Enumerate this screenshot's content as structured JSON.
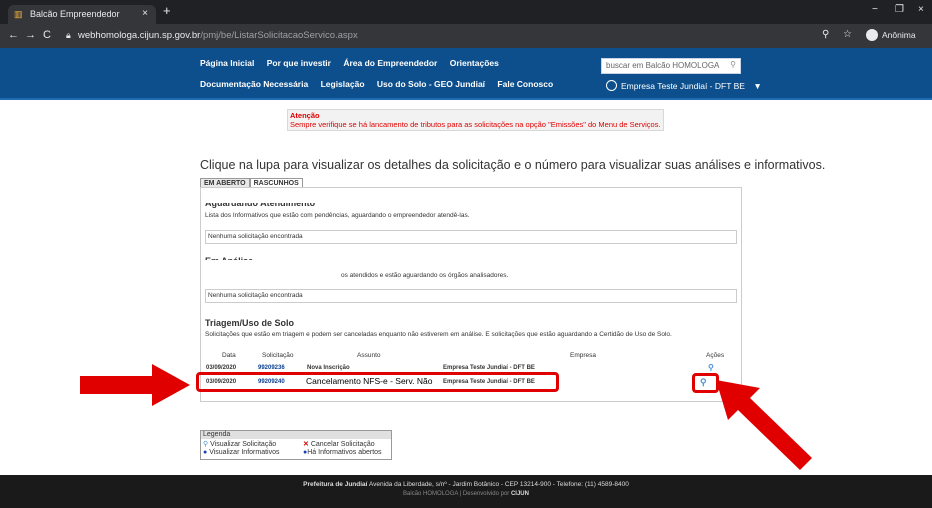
{
  "browser": {
    "tab_title": "Balcão Empreendedor",
    "tab_close": "×",
    "new_tab": "+",
    "url_host": "webhomologa.cijun.sp.gov.br",
    "url_path": "/pmj/be/ListarSolicitacaoServico.aspx",
    "profile_label": "Anônima",
    "window_controls": [
      "−",
      "❐",
      "×"
    ]
  },
  "site": {
    "nav_row1": [
      "Página Inicial",
      "Por que investir",
      "Área do Empreendedor",
      "Orientações"
    ],
    "nav_row2": [
      "Documentação Necessária",
      "Legislação",
      "Uso do Solo - GEO Jundiaí",
      "Fale Conosco"
    ],
    "search_placeholder": "buscar em Balcão HOMOLOGA",
    "company": "Empresa Teste Jundiaí - DFT BE",
    "company_caret": "▼"
  },
  "alert": {
    "title": "Atenção",
    "message": "Sempre verifique se há lancamento de tributos para as solicitações na opção \"Emissões\" do Menu de Serviços."
  },
  "main": {
    "title": "Clique na lupa para visualizar os detalhes da solicitação e o número para visualizar suas análises e informativos.",
    "tabs": [
      "EM ABERTO",
      "RASCUNHOS"
    ],
    "section1": {
      "heading": "Aguardando Atendimento",
      "description": "Lista dos Informativos que estão com pendências, aguardando o empreendedor atendê-las.",
      "empty": "Nenhuma solicitação encontrada"
    },
    "section2": {
      "heading": "Em Análise",
      "description": "os atendidos e estão aguardando os órgãos analisadores.",
      "empty": "Nenhuma solicitação encontrada"
    },
    "section3": {
      "heading": "Triagem/Uso de Solo",
      "description": "Solicitações que estão em triagem e podem ser canceladas enquanto não estiverem em análise. E solicitações que estão aguardando a Certidão de Uso de Solo.",
      "columns": [
        "Data",
        "Solicitação",
        "Assunto",
        "Empresa",
        "Ações"
      ],
      "rows": [
        {
          "data": "03/09/2020",
          "solicitacao": "99209236",
          "assunto": "Nova Inscrição",
          "empresa": "Empresa Teste Jundiaí - DFT BE"
        },
        {
          "data": "03/09/2020",
          "solicitacao": "99209240",
          "assunto": "Cancelamento NFS-e - Serv. Não",
          "empresa": "Empresa Teste Jundiaí - DFT BE"
        }
      ]
    }
  },
  "legend": {
    "title": "Legenda",
    "items": [
      "Visualizar Solicitação",
      "Cancelar Solicitação",
      "Visualizar Informativos",
      "Há Informativos abertos"
    ]
  },
  "footer": {
    "bold": "Prefeitura de Jundiaí",
    "address": "Avenida da Liberdade, s/nº - Jardim Botânico - CEP 13214-900 - Telefone: (11) 4589-8400",
    "line2": "Balcão HOMOLOGA | Desenvolvido por",
    "line2_bold": "CIJUN"
  },
  "colors": {
    "header_blue": "#0d4f8c",
    "highlight_red": "#e00000",
    "footer": "#1a1a1a"
  }
}
